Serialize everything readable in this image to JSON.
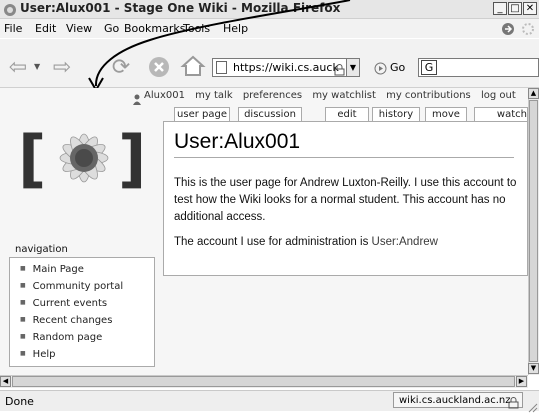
{
  "window": {
    "title": "User:Alux001 - Stage One Wiki - Mozilla Firefox"
  },
  "menu": [
    {
      "label": "File"
    },
    {
      "label": "Edit"
    },
    {
      "label": "View"
    },
    {
      "label": "Go"
    },
    {
      "label": "Bookmarks"
    },
    {
      "label": "Tools"
    },
    {
      "label": "Help"
    }
  ],
  "toolbar": {
    "url": "https://wiki.cs.auck",
    "go_label": "Go"
  },
  "user_links": [
    "Alux001",
    "my talk",
    "preferences",
    "my watchlist",
    "my contributions",
    "log out"
  ],
  "tabs": [
    {
      "label": "user page"
    },
    {
      "label": "discussion"
    },
    {
      "label": "edit"
    },
    {
      "label": "history"
    },
    {
      "label": "move"
    },
    {
      "label": "watch"
    }
  ],
  "article": {
    "title": "User:Alux001",
    "para1": "This is the user page for Andrew Luxton-Reilly. I use this account to test how the Wiki looks for a normal student. This account has no additional access.",
    "para2_prefix": "The account I use for administration is ",
    "para2_link": "User:Andrew"
  },
  "navigation": {
    "heading": "navigation",
    "items": [
      "Main Page",
      "Community portal",
      "Current events",
      "Recent changes",
      "Random page",
      "Help"
    ]
  },
  "status": {
    "text": "Done",
    "domain": "wiki.cs.auckland.ac.nz"
  },
  "colors": {
    "link": "#3a3a3a",
    "border": "#aaaaaa",
    "chrome": "#f2f2f2"
  }
}
